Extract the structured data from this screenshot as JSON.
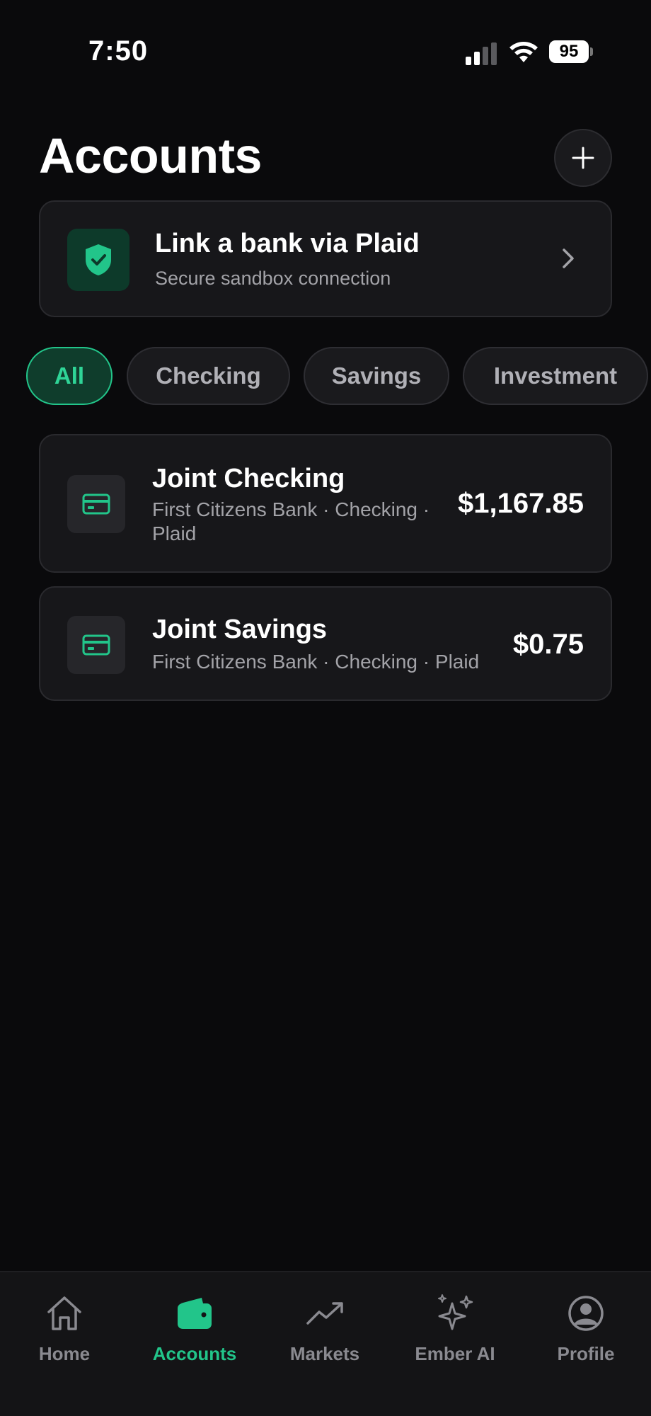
{
  "status": {
    "time": "7:50",
    "battery": "95"
  },
  "header": {
    "title": "Accounts"
  },
  "plaid": {
    "title": "Link a bank via Plaid",
    "subtitle": "Secure sandbox connection"
  },
  "filters": [
    {
      "label": "All",
      "active": true
    },
    {
      "label": "Checking",
      "active": false
    },
    {
      "label": "Savings",
      "active": false
    },
    {
      "label": "Investment",
      "active": false
    }
  ],
  "accounts": [
    {
      "name": "Joint Checking",
      "meta_line1": "First Citizens Bank · Checking ·",
      "meta_line2": "Plaid",
      "balance": "$1,167.85"
    },
    {
      "name": "Joint Savings",
      "meta_line1": "First Citizens Bank · Checking · Plaid",
      "balance": "$0.75"
    }
  ],
  "tabs": [
    {
      "label": "Home",
      "icon": "home-icon",
      "active": false
    },
    {
      "label": "Accounts",
      "icon": "wallet-icon",
      "active": true
    },
    {
      "label": "Markets",
      "icon": "trending-up-icon",
      "active": false
    },
    {
      "label": "Ember AI",
      "icon": "sparkles-icon",
      "active": false
    },
    {
      "label": "Profile",
      "icon": "user-circle-icon",
      "active": false
    }
  ],
  "colors": {
    "accent": "#22c58a",
    "background": "#0a0a0c",
    "card": "#17171a"
  }
}
